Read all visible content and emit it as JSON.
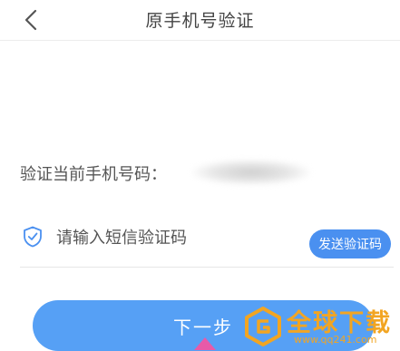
{
  "header": {
    "title": "原手机号验证",
    "back_icon": "chevron-left-icon"
  },
  "verify": {
    "label": "验证当前手机号码："
  },
  "sms": {
    "placeholder": "请输入短信验证码",
    "shield_icon": "shield-check-icon",
    "send_label": "发送验证码"
  },
  "next_button": {
    "label": "下一步"
  },
  "watermark": {
    "main": "全球下载",
    "sub": "www.qq241.com"
  },
  "colors": {
    "accent": "#4a90f0",
    "button": "#56a0f5",
    "watermark": "#f2a522"
  }
}
